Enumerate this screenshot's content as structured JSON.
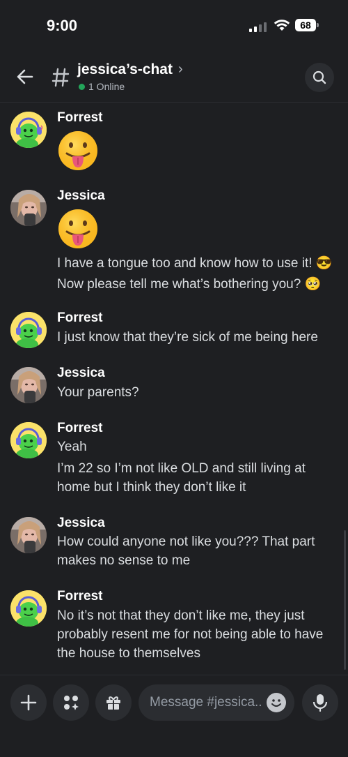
{
  "status": {
    "time": "9:00",
    "battery": "68"
  },
  "header": {
    "channel": "jessica’s-chat",
    "online": "1 Online"
  },
  "messages": [
    {
      "author": "Forrest",
      "emoji": "tongue-out-emoji",
      "lines": []
    },
    {
      "author": "Jessica",
      "emoji": "tongue-out-emoji",
      "lines": [
        "I have a tongue too and know how to use it! 😎",
        "Now please tell me what’s bothering you? 🥺"
      ]
    },
    {
      "author": "Forrest",
      "lines": [
        "I just know that they’re sick of me being here"
      ]
    },
    {
      "author": "Jessica",
      "lines": [
        "Your parents?"
      ]
    },
    {
      "author": "Forrest",
      "lines": [
        "Yeah",
        "I’m 22 so I’m not like OLD and still living at",
        "home but I think they don’t like it"
      ]
    },
    {
      "author": "Jessica",
      "lines": [
        "How could anyone not like you??? That part",
        "makes no sense to me"
      ]
    },
    {
      "author": "Forrest",
      "lines": [
        "No it’s not that they don’t like me, they just",
        "probably resent me for not being able to have",
        "the house to themselves"
      ]
    }
  ],
  "composer": {
    "placeholder": "Message #jessica.."
  },
  "colors": {
    "accent_online": "#23a55a",
    "background": "#1e1f22",
    "surface": "#2b2d31",
    "forrest_avatar_bg": "#fbe26a"
  }
}
